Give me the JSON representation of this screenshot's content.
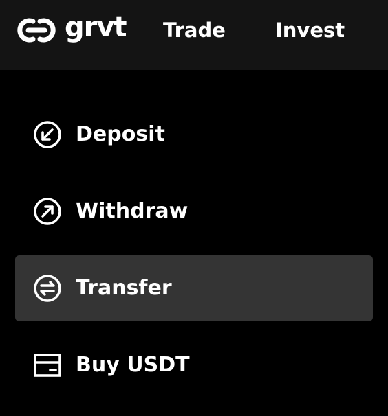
{
  "colors": {
    "page_bg": "#000000",
    "topbar_bg": "#141414",
    "active_item_bg": "#343434",
    "text": "#ffffff"
  },
  "header": {
    "brand": "grvt",
    "nav": [
      {
        "label": "Trade"
      },
      {
        "label": "Invest"
      }
    ]
  },
  "menu": {
    "active": "Transfer",
    "items": [
      {
        "label": "Deposit",
        "icon": "arrow-down-left-circle-icon"
      },
      {
        "label": "Withdraw",
        "icon": "arrow-up-right-circle-icon"
      },
      {
        "label": "Transfer",
        "icon": "transfer-arrows-circle-icon"
      },
      {
        "label": "Buy USDT",
        "icon": "card-icon"
      }
    ]
  }
}
